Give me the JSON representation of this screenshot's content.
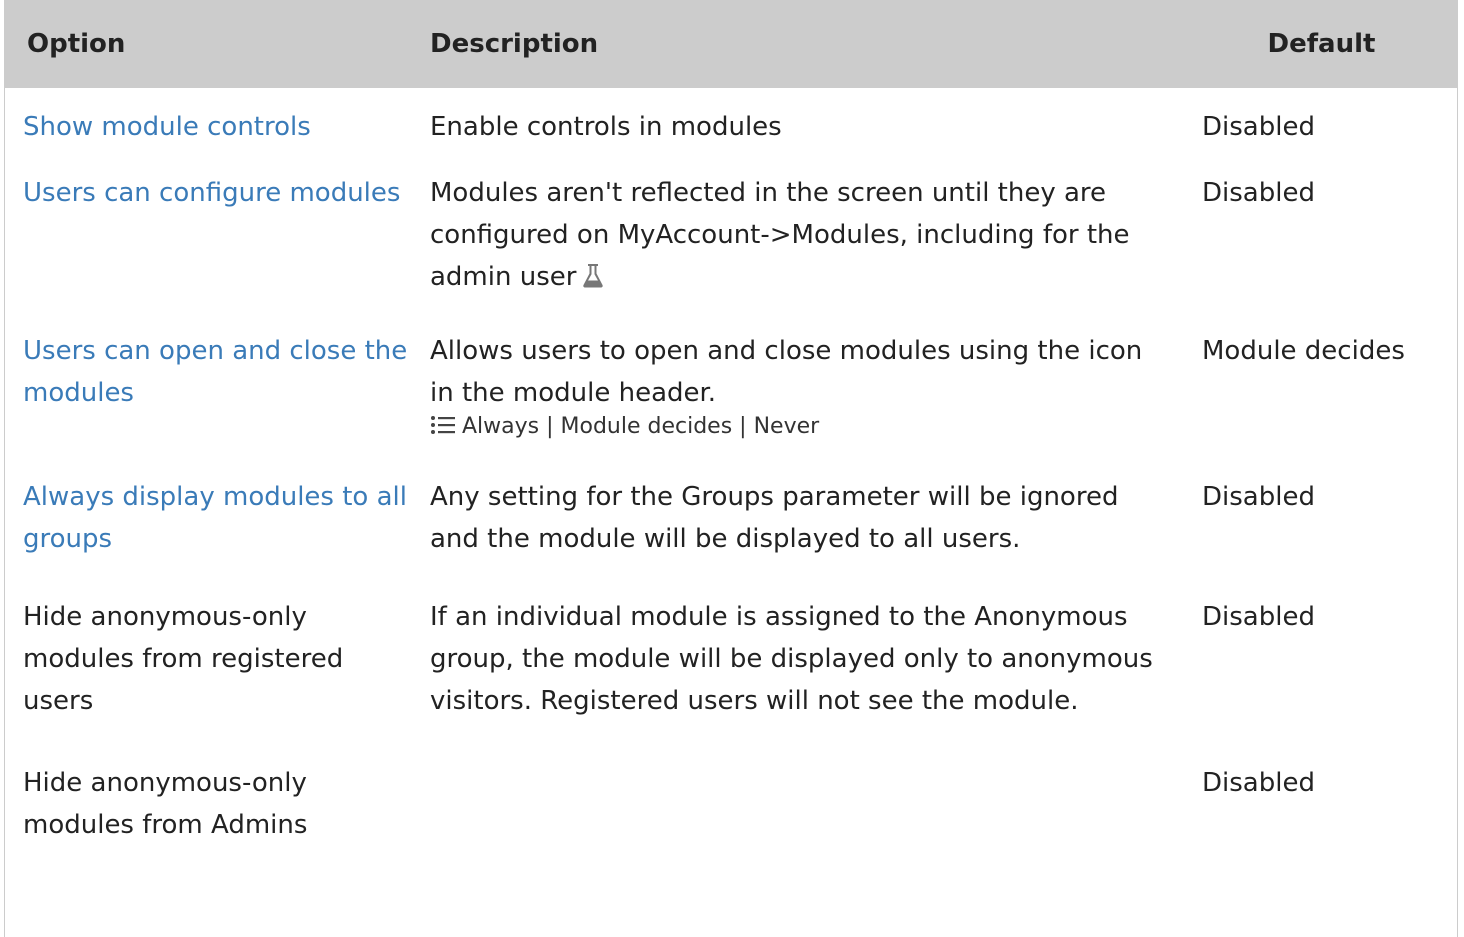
{
  "table": {
    "headers": {
      "option": "Option",
      "description": "Description",
      "default": "Default"
    },
    "rows": [
      {
        "option": "Show module controls",
        "option_is_link": true,
        "description": "Enable controls in modules",
        "default": "Disabled"
      },
      {
        "option": "Users can configure modules",
        "option_is_link": true,
        "description": "Modules aren't reflected in the screen until they are configured on MyAccount->Modules, including for the admin user",
        "description_icon": "flask-icon",
        "default": "Disabled"
      },
      {
        "option": "Users can open and close the modules",
        "option_is_link": true,
        "description": "Allows users to open and close modules using the icon in the module header.",
        "options_icon": "list-icon",
        "options_text": "Always | Module decides | Never",
        "default": "Module decides"
      },
      {
        "option": "Always display modules to all groups",
        "option_is_link": true,
        "description": "Any setting for the Groups parameter will be ignored and the module will be displayed to all users.",
        "default": "Disabled"
      },
      {
        "option": "Hide anonymous-only modules from registered users",
        "option_is_link": false,
        "description": "If an individual module is assigned to the Anonymous group, the module will be displayed only to anonymous visitors. Registered users will not see the module.",
        "default": "Disabled"
      },
      {
        "option": "Hide anonymous-only modules from Admins",
        "option_is_link": false,
        "description": "",
        "default": "Disabled"
      }
    ]
  },
  "colors": {
    "header_bg": "#cccccc",
    "link": "#3a7bb8",
    "text": "#222222"
  }
}
